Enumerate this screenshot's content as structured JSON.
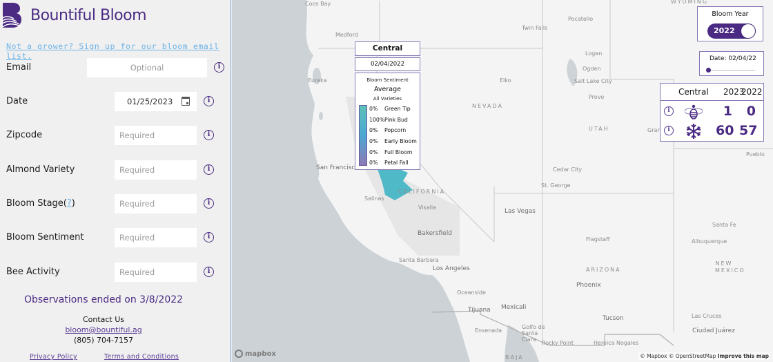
{
  "brand": {
    "name": "Bountiful Bloom",
    "logo_icon": "bountiful-bloom-logo-icon"
  },
  "sidebar": {
    "signup_link": "Not a grower? Sign up for our bloom email list.",
    "form": {
      "email": {
        "label": "Email",
        "value": "",
        "placeholder": "Optional"
      },
      "date": {
        "label": "Date",
        "value": "01/25/2023",
        "icon": "calendar-icon"
      },
      "zipcode": {
        "label": "Zipcode",
        "value": "",
        "placeholder": "Required"
      },
      "almond_variety": {
        "label": "Almond Variety",
        "value": "",
        "placeholder": "Required"
      },
      "bloom_stage": {
        "label": "Bloom Stage(",
        "help": "?",
        "label_end": ")",
        "value": "",
        "placeholder": "Required"
      },
      "bloom_sentiment": {
        "label": "Bloom Sentiment",
        "value": "",
        "placeholder": "Required"
      },
      "bee_activity": {
        "label": "Bee Activity",
        "value": "",
        "placeholder": "Required"
      }
    },
    "info_glyph": "i",
    "observations_ended": "Observations ended on 3/8/2022",
    "contact": {
      "heading": "Contact Us",
      "email": "bloom@bountiful.ag",
      "phone": "(805) 704-7157"
    },
    "footer": {
      "privacy": "Privacy Policy",
      "terms": "Terms and Conditions"
    }
  },
  "map": {
    "popup": {
      "region": "Central",
      "date": "02/04/2022",
      "legend_title": "Bloom Sentiment",
      "legend_subtitle": "Average",
      "legend_scope": "All Varieties",
      "stages": [
        {
          "pct": "0%",
          "name": "Green Tip"
        },
        {
          "pct": "100%",
          "name": "Pink Bud"
        },
        {
          "pct": "0%",
          "name": "Popcorn"
        },
        {
          "pct": "0%",
          "name": "Early Bloom"
        },
        {
          "pct": "0%",
          "name": "Full Bloom"
        },
        {
          "pct": "0%",
          "name": "Petal Fall"
        }
      ],
      "gradient_colors": [
        "#5ec1b8",
        "#4ca8d3",
        "#8e79b5"
      ]
    },
    "region_fill_color": "#4fb9c8",
    "bloom_year": {
      "title": "Bloom Year",
      "selected": "2022"
    },
    "date_slider": {
      "label": "Date: 02/04/22",
      "position_fraction": 0.0
    },
    "stats": {
      "region": "Central",
      "years": [
        "2023",
        "2022"
      ],
      "rows": [
        {
          "icon": "bee-icon",
          "values": [
            "1",
            "0"
          ]
        },
        {
          "icon": "snowflake-icon",
          "values": [
            "60",
            "57"
          ]
        }
      ]
    },
    "labels": {
      "cities": [
        "Coos Bay",
        "Medford",
        "Eureka",
        "San Francisco",
        "Salinas",
        "Visalia",
        "Bakersfield",
        "Santa Barbara",
        "Los Angeles",
        "Oceanside",
        "Tijuana",
        "Ensenada",
        "Mexicali",
        "Golfo de Santa Clara",
        "Rocky Point",
        "Heroica Nogales",
        "Las Vegas",
        "St. George",
        "Cedar City",
        "Flagstaff",
        "Phoenix",
        "Tucson",
        "Twin Falls",
        "Pocatello",
        "Logan",
        "Ogden",
        "Salt Lake City",
        "Provo",
        "Elko",
        "Grand",
        "Pueblo",
        "Santa Fe",
        "Albuquerque",
        "Las Cruces",
        "Ciudad Juárez"
      ],
      "states": [
        "NEVADA",
        "UTAH",
        "CALIFORNIA",
        "ARIZONA",
        "NEW MEXICO",
        "WYOMING",
        "BAJA"
      ]
    },
    "mapbox_logo": "mapbox",
    "attribution": "© Mapbox © OpenStreetMap",
    "improve": "Improve this map"
  }
}
